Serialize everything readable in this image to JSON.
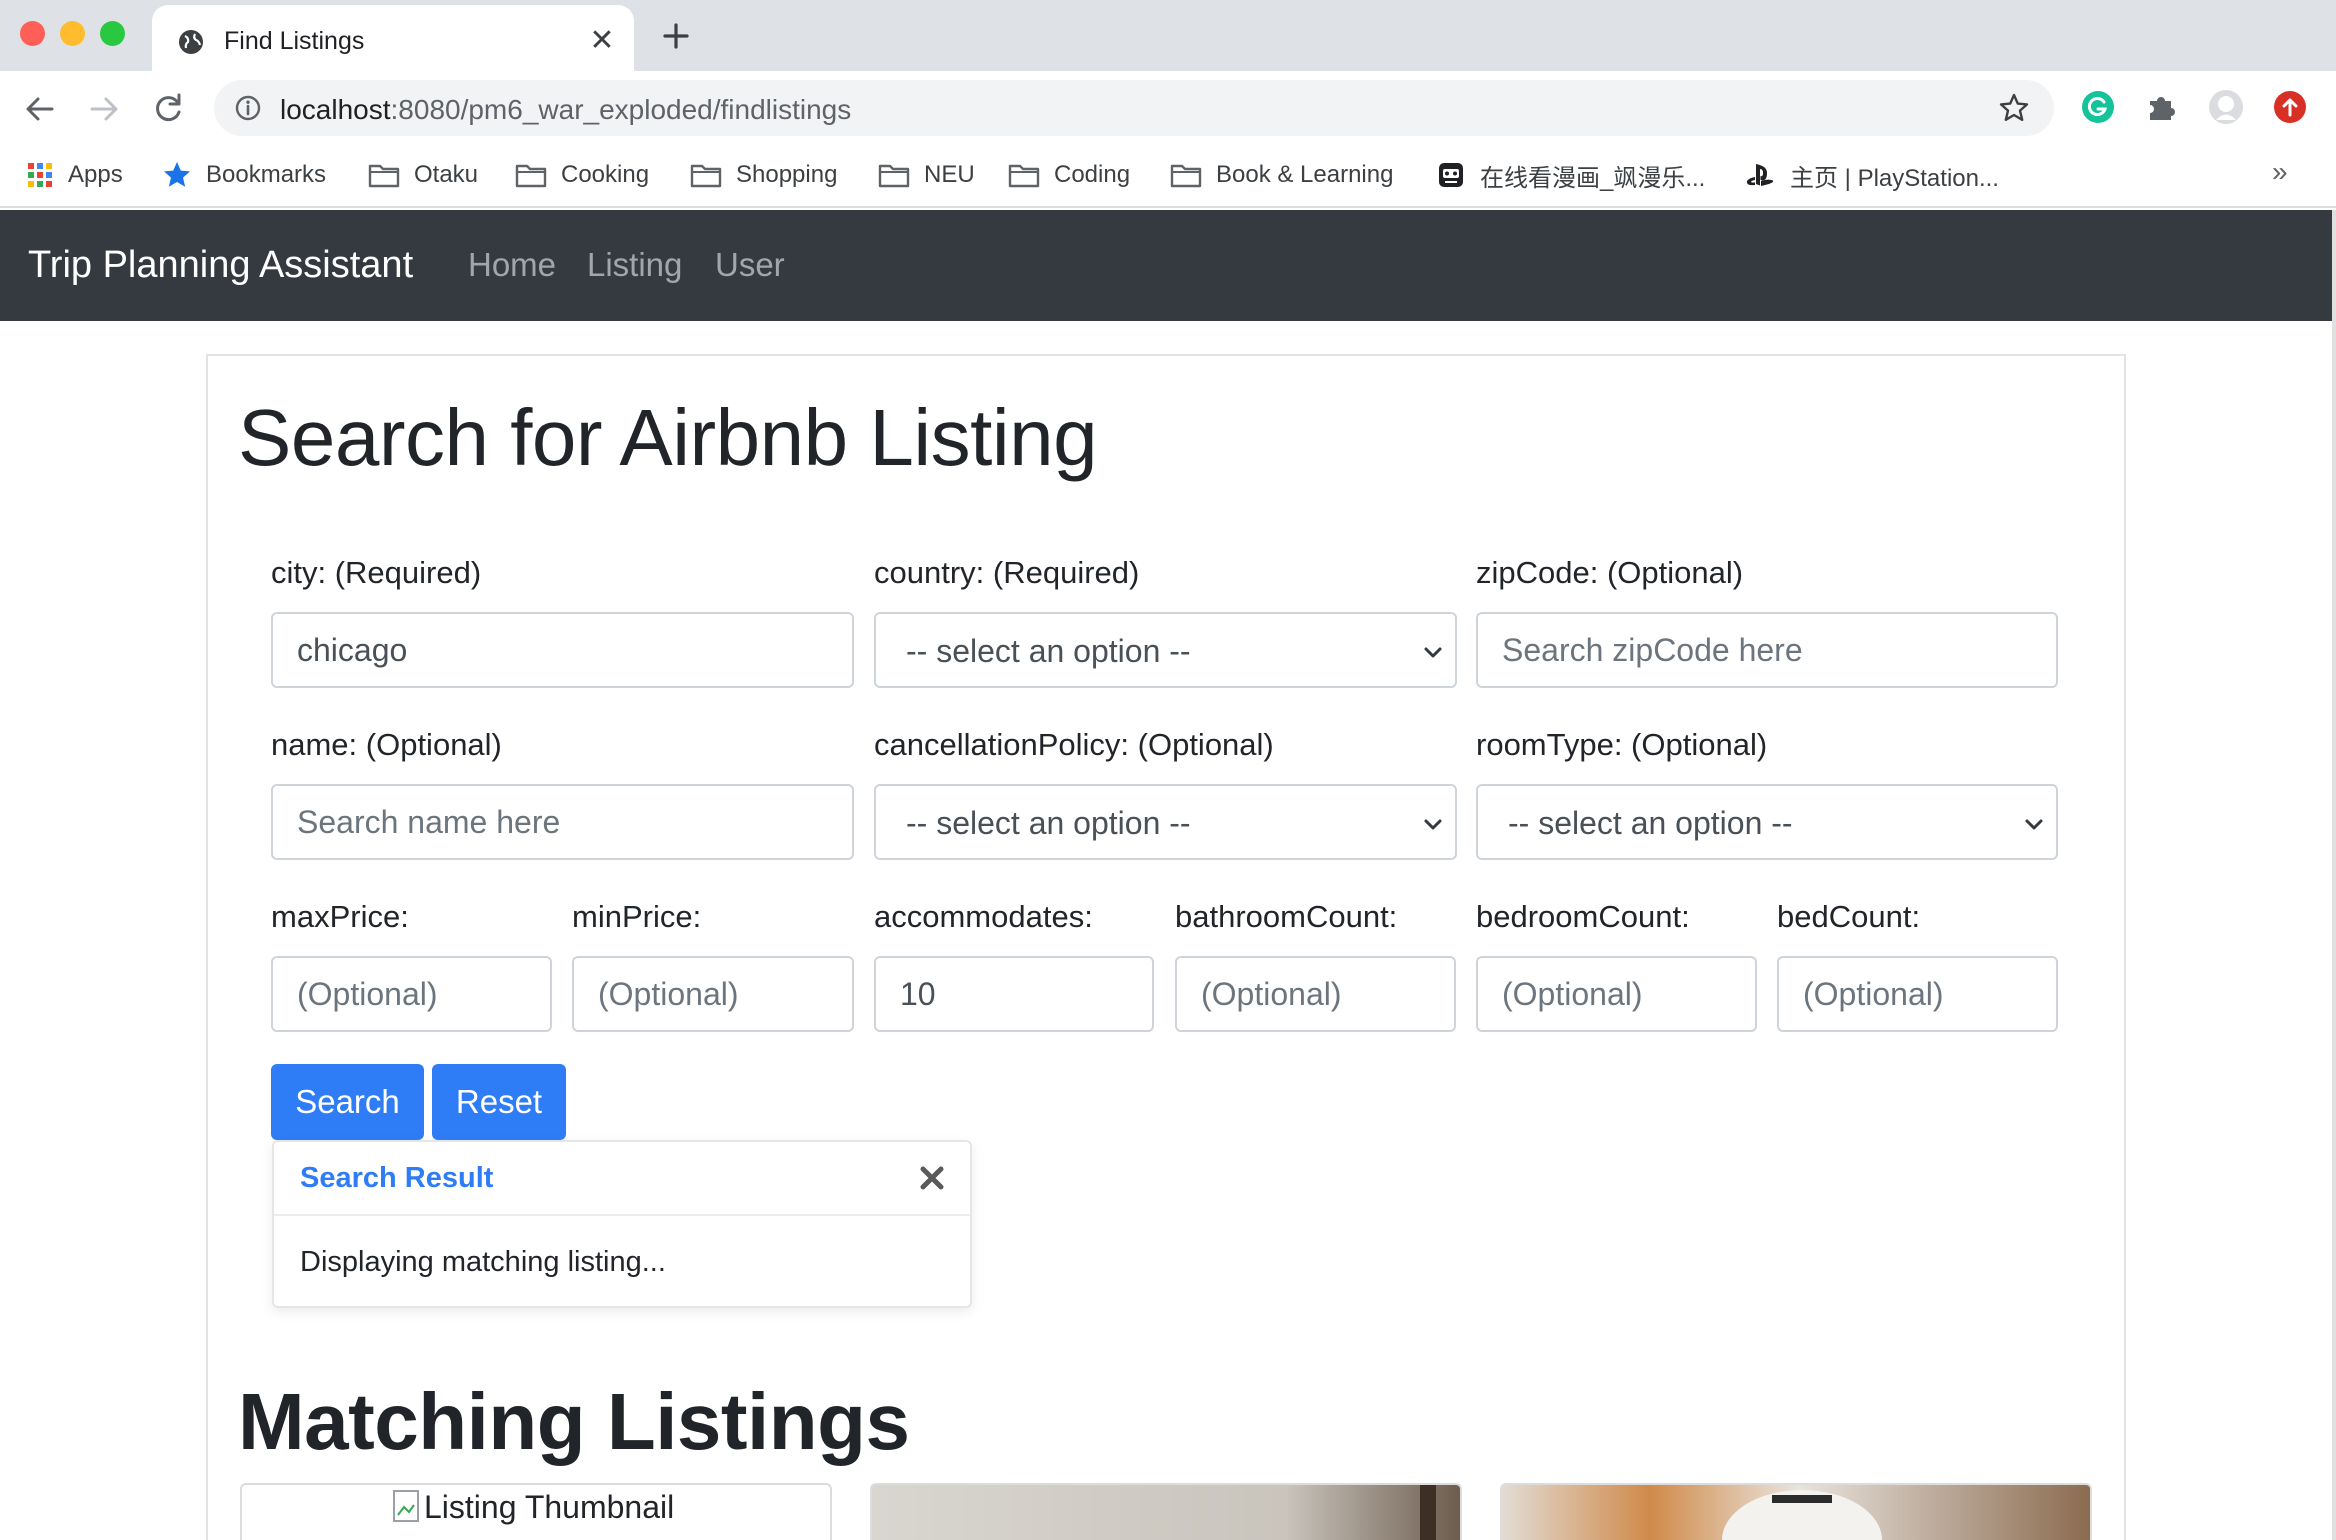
{
  "browser": {
    "tab_title": "Find Listings",
    "url_host": "localhost",
    "url_path": ":8080/pm6_war_exploded/findlistings",
    "bookmarks": [
      {
        "label": "Apps",
        "icon": "apps-grid-icon"
      },
      {
        "label": "Bookmarks",
        "icon": "star-icon"
      },
      {
        "label": "Otaku",
        "icon": "folder-icon"
      },
      {
        "label": "Cooking",
        "icon": "folder-icon"
      },
      {
        "label": "Shopping",
        "icon": "folder-icon"
      },
      {
        "label": "NEU",
        "icon": "folder-icon"
      },
      {
        "label": "Coding",
        "icon": "folder-icon"
      },
      {
        "label": "Book & Learning",
        "icon": "folder-icon"
      },
      {
        "label": "在线看漫画_飒漫乐...",
        "icon": "site-icon"
      },
      {
        "label": "主页 | PlayStation...",
        "icon": "playstation-icon"
      }
    ],
    "more_label": "»"
  },
  "navbar": {
    "brand": "Trip Planning Assistant",
    "links": [
      "Home",
      "Listing",
      "User"
    ]
  },
  "search": {
    "heading": "Search for Airbnb Listing",
    "city": {
      "label": "city: (Required)",
      "value": "chicago"
    },
    "country": {
      "label": "country: (Required)",
      "selected": "-- select an option --"
    },
    "zipcode": {
      "label": "zipCode: (Optional)",
      "placeholder": "Search zipCode here"
    },
    "name": {
      "label": "name: (Optional)",
      "placeholder": "Search name here"
    },
    "cancellation": {
      "label": "cancellationPolicy: (Optional)",
      "selected": "-- select an option --"
    },
    "roomtype": {
      "label": "roomType: (Optional)",
      "selected": "-- select an option --"
    },
    "maxprice": {
      "label": "maxPrice:",
      "placeholder": "(Optional)"
    },
    "minprice": {
      "label": "minPrice:",
      "placeholder": "(Optional)"
    },
    "accommodates": {
      "label": "accommodates:",
      "value": "10"
    },
    "bathroom": {
      "label": "bathroomCount:",
      "placeholder": "(Optional)"
    },
    "bedroom": {
      "label": "bedroomCount:",
      "placeholder": "(Optional)"
    },
    "bed": {
      "label": "bedCount:",
      "placeholder": "(Optional)"
    },
    "search_button": "Search",
    "reset_button": "Reset"
  },
  "toast": {
    "title": "Search Result",
    "message": "Displaying matching listing..."
  },
  "results": {
    "heading": "Matching Listings",
    "thumbnail_alt": "Listing Thumbnail"
  },
  "colors": {
    "navbar": "#343a40",
    "primary": "#2f7df6"
  }
}
